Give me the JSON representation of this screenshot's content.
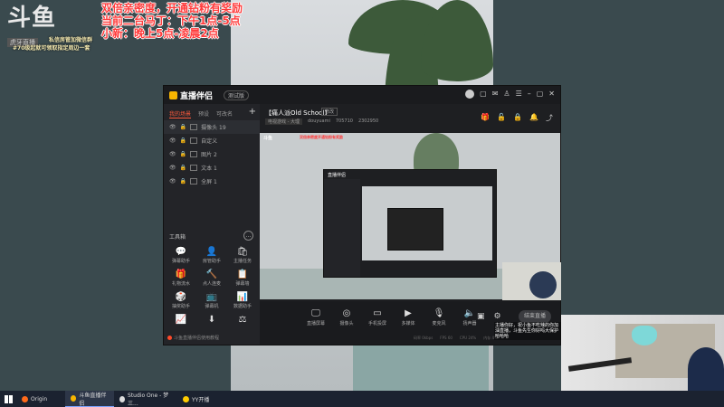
{
  "overlay": {
    "logo_main": "斗鱼",
    "logo_sub": "虎牙直播",
    "line1": "私信房管加微信群",
    "line2": "#70级起就可领取指定周边一套"
  },
  "promo": {
    "line1": "双倍亲密度，开通钻粉有奖励",
    "line2": "当前二台马丁：下午1点-5点",
    "line3": "小新：晚上5点-凌晨2点"
  },
  "app": {
    "brand": "直播伴侣",
    "version": "测试版",
    "left_tabs": [
      "我的场景",
      "预设",
      "可改名"
    ],
    "add_tab": "+",
    "scenes": [
      "摄像头 19",
      "自定义",
      "图片 2",
      "文本 1",
      "全屏 1"
    ],
    "tools_title": "工具箱",
    "tools": [
      {
        "icon": "💬",
        "label": "弹幕助手"
      },
      {
        "icon": "👤",
        "label": "房管助手"
      },
      {
        "icon": "🛍",
        "label": "主播任务"
      },
      {
        "icon": "🎁",
        "label": "礼物流水"
      },
      {
        "icon": "🔨",
        "label": "点人连麦"
      },
      {
        "icon": "📋",
        "label": "弹幕墙"
      },
      {
        "icon": "🎲",
        "label": "抽奖助手"
      },
      {
        "icon": "📺",
        "label": "弹幕机"
      },
      {
        "icon": "📊",
        "label": "数据助手"
      },
      {
        "icon": "📈",
        "label": ""
      },
      {
        "icon": "⬇",
        "label": ""
      },
      {
        "icon": "⚖",
        "label": ""
      }
    ],
    "left_footer": "斗鱼直播伴侣使用教程",
    "room_title": "【痛人派Old School】",
    "room_tag": "修改",
    "room_category": "电视游戏 - 大理",
    "room_id": "douyuami",
    "room_fans": "705710",
    "room_viewers": "2302950",
    "bottom_controls": [
      {
        "icon": "🖵",
        "label": "直播屏幕"
      },
      {
        "icon": "◎",
        "label": "摄像头"
      },
      {
        "icon": "▭",
        "label": "手机投屏"
      },
      {
        "icon": "▶",
        "label": "多媒体"
      },
      {
        "icon": "🎙",
        "label": "麦克风"
      },
      {
        "icon": "🔈",
        "label": "扬声器"
      }
    ],
    "start_button": "结束直播",
    "stats": [
      "码率 0kbps",
      "FPS 60",
      "CPU 24%",
      "内存 4%"
    ]
  },
  "nested": {
    "brand": "直播伴侣",
    "overlay_logo": "斗鱼",
    "promo": "双倍亲密度开通钻粉有奖励"
  },
  "chat": {
    "text": "主播你好，祝小鱼不吃辣的你加油直播，斗鱼先生你好吗大保护哈哈哈"
  },
  "taskbar": [
    {
      "label": "Origin",
      "color": "#ff6a1a"
    },
    {
      "label": "斗鱼直播伴侣",
      "color": "#f7b500"
    },
    {
      "label": "Studio One - 梦三...",
      "color": "#dddddd"
    },
    {
      "label": "YY开播",
      "color": "#ffcc00"
    }
  ]
}
